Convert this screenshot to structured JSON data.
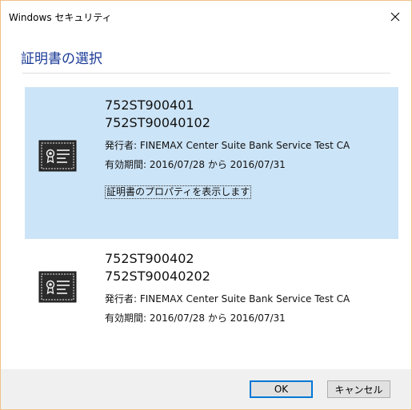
{
  "window": {
    "title": "Windows セキュリティ",
    "heading": "証明書の選択"
  },
  "icons": {
    "close": "close-icon",
    "certificate": "certificate-icon"
  },
  "colors": {
    "selected_bg": "#cce4f7",
    "heading": "#1a3a96",
    "ok_border": "#0078d7",
    "icon_dark": "#2b2b2b"
  },
  "certificates": [
    {
      "name_line1": "752ST900401",
      "name_line2": "752ST90040102",
      "issuer": "発行者: FINEMAX Center Suite Bank Service Test CA",
      "validity": "有効期間: 2016/07/28 から 2016/07/31",
      "properties_link": "証明書のプロパティを表示します",
      "selected": true
    },
    {
      "name_line1": "752ST900402",
      "name_line2": "752ST90040202",
      "issuer": "発行者: FINEMAX Center Suite Bank Service Test CA",
      "validity": "有効期間: 2016/07/28 から 2016/07/31",
      "selected": false
    }
  ],
  "buttons": {
    "ok": "OK",
    "cancel": "キャンセル"
  }
}
